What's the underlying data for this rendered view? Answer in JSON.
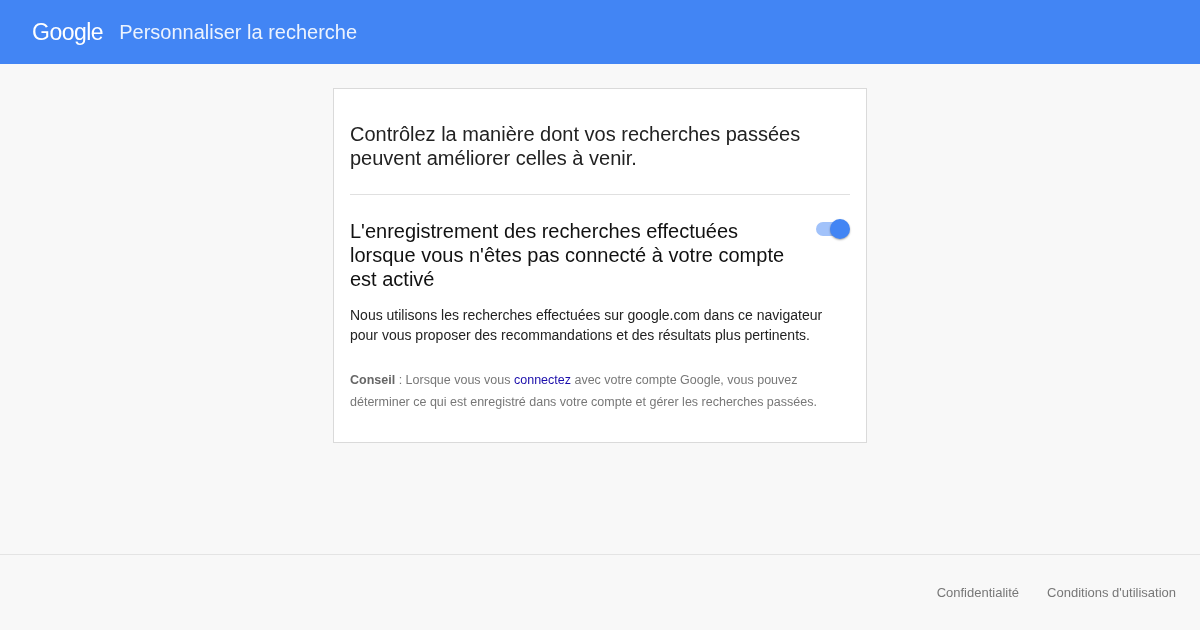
{
  "header": {
    "logo": "Google",
    "title": "Personnaliser la recherche"
  },
  "card": {
    "heading": "Contrôlez la manière dont vos recherches passées peuvent améliorer celles à venir.",
    "setting": {
      "title": "L'enregistrement des recherches effectuées lorsque vous n'êtes pas connecté à votre compte est activé",
      "on": true,
      "description": "Nous utilisons les recherches effectuées sur google.com dans ce navigateur pour vous proposer des recommandations et des résultats plus pertinents."
    },
    "tip": {
      "before": "**Conseil** : Lorsque vous vous",
      "link": "connectez",
      "after": "avec votre compte Google, vous pouvez déterminer ce qui est enregistré dans votre compte et gérer les recherches passées."
    }
  },
  "footer": {
    "links": [
      "Confidentialité",
      "Conditions d'utilisation"
    ]
  }
}
